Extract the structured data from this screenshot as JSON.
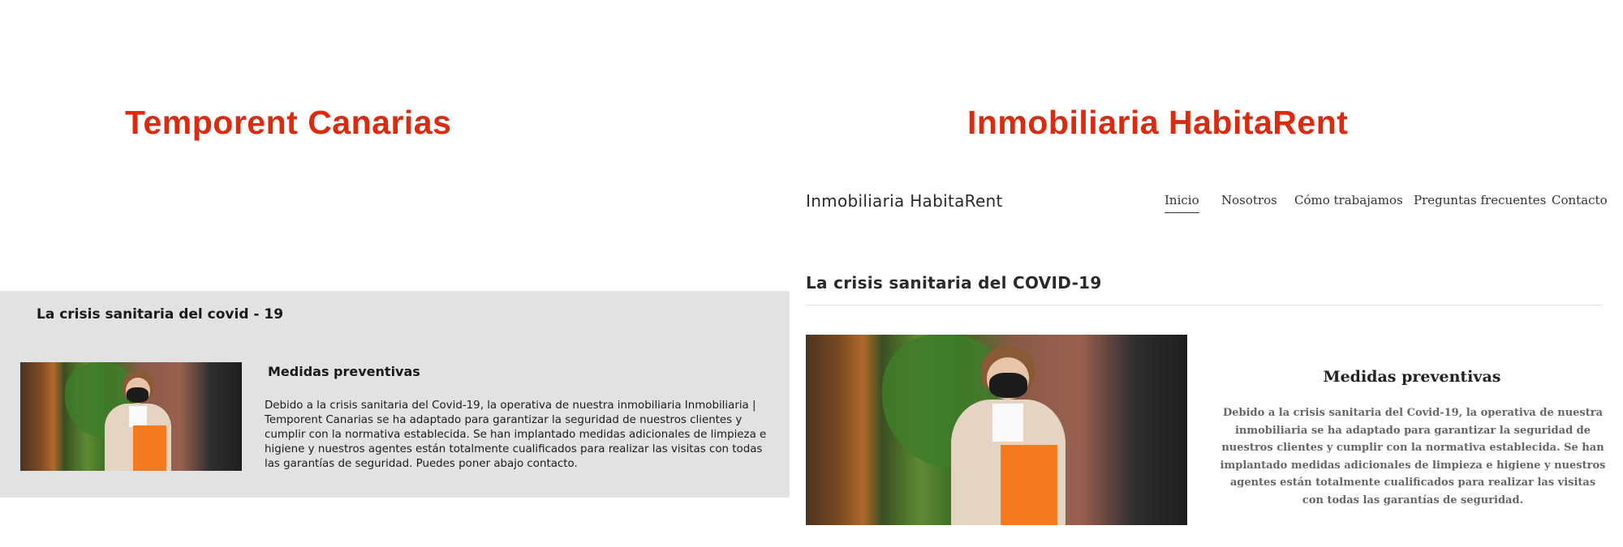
{
  "left": {
    "title": "Temporent Canarias",
    "heading": "La crisis sanitaria del covid - 19",
    "subheading": "Medidas preventivas",
    "body": "Debido a la crisis sanitaria del Covid-19, la operativa de nuestra inmobiliaria Inmobiliaria | Temporent Canarias se ha adaptado para garantizar la seguridad de nuestros clientes y cumplir con la normativa establecida. Se han implantado medidas adicionales de limpieza e higiene y nuestros agentes están totalmente cualificados para realizar las visitas con todas las garantías de seguridad. Puedes poner abajo contacto."
  },
  "right": {
    "title": "Inmobiliaria HabitaRent",
    "site_name": "Inmobiliaria HabitaRent",
    "nav": [
      "Inicio",
      "Nosotros",
      "Cómo trabajamos",
      "Preguntas frecuentes",
      "Contacto"
    ],
    "active_nav": "Inicio",
    "section_title": "La crisis sanitaria del COVID-19",
    "subheading": "Medidas preventivas",
    "body": "Debido a la crisis sanitaria del Covid-19, la operativa de nuestra inmobiliaria se ha adaptado para garantizar la seguridad de nuestros clientes y cumplir con la normativa establecida. Se han implantado medidas adicionales de limpieza e higiene y nuestros agentes están totalmente cualificados para realizar las visitas con todas las garantías de seguridad."
  },
  "colors": {
    "title_red": "#dd2a0e",
    "left_panel_bg": "#e2e2e2",
    "right_body_text": "#666666"
  }
}
